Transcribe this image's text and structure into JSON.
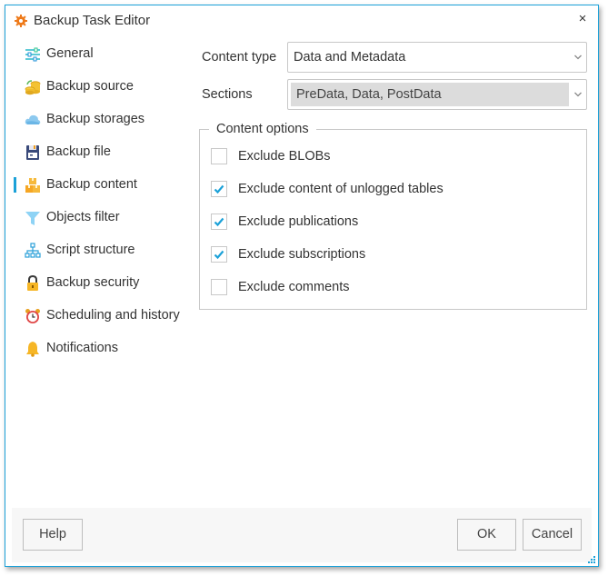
{
  "window": {
    "title": "Backup Task Editor",
    "title_icon": "gear-icon",
    "close_label": "×",
    "accent_color": "#1ba1d8"
  },
  "sidebar": {
    "selected_index": 4,
    "items": [
      {
        "label": "General",
        "icon": "sliders-icon"
      },
      {
        "label": "Backup source",
        "icon": "coins-icon"
      },
      {
        "label": "Backup storages",
        "icon": "cloud-icon"
      },
      {
        "label": "Backup file",
        "icon": "floppy-disk-icon"
      },
      {
        "label": "Backup content",
        "icon": "boxes-icon"
      },
      {
        "label": "Objects filter",
        "icon": "filter-icon"
      },
      {
        "label": "Script structure",
        "icon": "hierarchy-icon"
      },
      {
        "label": "Backup security",
        "icon": "lock-icon"
      },
      {
        "label": "Scheduling and history",
        "icon": "alarm-clock-icon"
      },
      {
        "label": "Notifications",
        "icon": "bell-icon"
      }
    ]
  },
  "form": {
    "content_type": {
      "label": "Content type",
      "value": "Data and Metadata"
    },
    "sections": {
      "label": "Sections",
      "value": "PreData, Data, PostData"
    }
  },
  "content_options": {
    "title": "Content options",
    "options": [
      {
        "label": "Exclude BLOBs",
        "checked": false
      },
      {
        "label": "Exclude content of unlogged tables",
        "checked": true
      },
      {
        "label": "Exclude publications",
        "checked": true
      },
      {
        "label": "Exclude subscriptions",
        "checked": true
      },
      {
        "label": "Exclude comments",
        "checked": false
      }
    ]
  },
  "footer": {
    "help_label": "Help",
    "ok_label": "OK",
    "cancel_label": "Cancel"
  }
}
